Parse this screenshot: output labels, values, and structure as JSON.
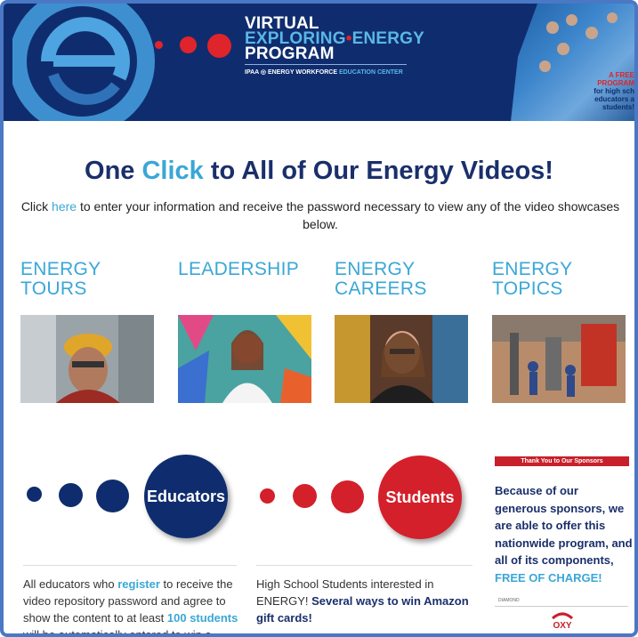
{
  "banner": {
    "title_line1": "VIRTUAL",
    "title_line2a": "EXPLORING",
    "title_sep": "•",
    "title_line2b": "ENERGY",
    "title_line3": "PROGRAM",
    "subtitle_a": "IPAA",
    "subtitle_b": "ENERGY WORKFORCE",
    "subtitle_c": "EDUCATION CENTER",
    "free_line1": "A FREE",
    "free_line2": "PROGRAM",
    "free_line3": "for high sch",
    "free_line4": "educators a",
    "free_line5": "students!"
  },
  "headline": {
    "part1": "One ",
    "click": "Click",
    "part2": " to All of Our Energy Videos!"
  },
  "intro": {
    "before": "Click ",
    "link": "here",
    "after": " to enter your information and receive the password necessary to view any of the video showcases below."
  },
  "categories": [
    {
      "title": "ENERGY TOURS"
    },
    {
      "title": "LEADERSHIP"
    },
    {
      "title": "ENERGY CAREERS"
    },
    {
      "title": "ENERGY TOPICS"
    }
  ],
  "educators": {
    "label": "Educators",
    "text_a": "All educators who ",
    "register": "register",
    "text_b": " to receive the video repository password and agree to show the content to at least ",
    "students_count": "100 students",
    "text_c": " will be automatically entered to win a"
  },
  "students": {
    "label": "Students",
    "text_a": "High School Students interested in ENERGY! ",
    "bold": "Several ways to win Amazon gift cards!"
  },
  "sponsors": {
    "bar": "Thank You to Our Sponsors",
    "text": "Because of our generous sponsors, we are able to offer this nationwide program, and all of its components, ",
    "free": "FREE OF CHARGE!",
    "tier": "DIAMOND",
    "logo": "OXY"
  },
  "colors": {
    "navy": "#1a2f6b",
    "cyan": "#3aa7d6",
    "red": "#e0242b",
    "banner": "#0f2d6e"
  }
}
